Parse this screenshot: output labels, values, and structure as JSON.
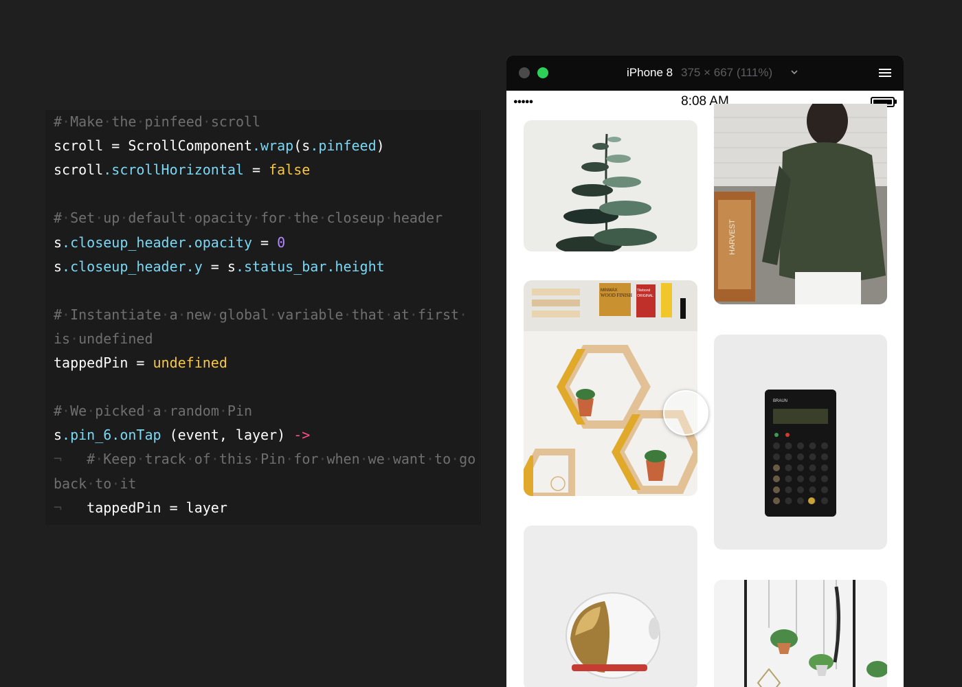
{
  "editor": {
    "lines": [
      {
        "segments": [
          {
            "text": "#",
            "c": "cm"
          },
          {
            "text": "·",
            "c": "ws"
          },
          {
            "text": "Make",
            "c": "cm"
          },
          {
            "text": "·",
            "c": "ws"
          },
          {
            "text": "the",
            "c": "cm"
          },
          {
            "text": "·",
            "c": "ws"
          },
          {
            "text": "pinfeed",
            "c": "cm"
          },
          {
            "text": "·",
            "c": "ws"
          },
          {
            "text": "scroll",
            "c": "cm"
          }
        ]
      },
      {
        "segments": [
          {
            "text": "scroll",
            "c": ""
          },
          {
            "text": " = ",
            "c": ""
          },
          {
            "text": "ScrollComponent",
            "c": ""
          },
          {
            "text": ".wrap",
            "c": "pr"
          },
          {
            "text": "(s",
            "c": ""
          },
          {
            "text": ".pinfeed",
            "c": "pr"
          },
          {
            "text": ")",
            "c": ""
          }
        ]
      },
      {
        "segments": [
          {
            "text": "scroll",
            "c": ""
          },
          {
            "text": ".scrollHorizontal",
            "c": "pr"
          },
          {
            "text": " = ",
            "c": ""
          },
          {
            "text": "false",
            "c": "kw"
          }
        ]
      },
      {
        "segments": []
      },
      {
        "segments": [
          {
            "text": "#",
            "c": "cm"
          },
          {
            "text": "·",
            "c": "ws"
          },
          {
            "text": "Set",
            "c": "cm"
          },
          {
            "text": "·",
            "c": "ws"
          },
          {
            "text": "up",
            "c": "cm"
          },
          {
            "text": "·",
            "c": "ws"
          },
          {
            "text": "default",
            "c": "cm"
          },
          {
            "text": "·",
            "c": "ws"
          },
          {
            "text": "opacity",
            "c": "cm"
          },
          {
            "text": "·",
            "c": "ws"
          },
          {
            "text": "for",
            "c": "cm"
          },
          {
            "text": "·",
            "c": "ws"
          },
          {
            "text": "the",
            "c": "cm"
          },
          {
            "text": "·",
            "c": "ws"
          },
          {
            "text": "closeup",
            "c": "cm"
          },
          {
            "text": "·",
            "c": "ws"
          },
          {
            "text": "header",
            "c": "cm"
          }
        ]
      },
      {
        "segments": [
          {
            "text": "s",
            "c": ""
          },
          {
            "text": ".closeup_header",
            "c": "pr"
          },
          {
            "text": ".opacity",
            "c": "pr"
          },
          {
            "text": " = ",
            "c": ""
          },
          {
            "text": "0",
            "c": "nm"
          }
        ]
      },
      {
        "segments": [
          {
            "text": "s",
            "c": ""
          },
          {
            "text": ".closeup_header",
            "c": "pr"
          },
          {
            "text": ".y",
            "c": "pr"
          },
          {
            "text": " = ",
            "c": ""
          },
          {
            "text": "s",
            "c": ""
          },
          {
            "text": ".status_bar",
            "c": "pr"
          },
          {
            "text": ".height",
            "c": "pr"
          }
        ]
      },
      {
        "segments": []
      },
      {
        "segments": [
          {
            "text": "#",
            "c": "cm"
          },
          {
            "text": "·",
            "c": "ws"
          },
          {
            "text": "Instantiate",
            "c": "cm"
          },
          {
            "text": "·",
            "c": "ws"
          },
          {
            "text": "a",
            "c": "cm"
          },
          {
            "text": "·",
            "c": "ws"
          },
          {
            "text": "new",
            "c": "cm"
          },
          {
            "text": "·",
            "c": "ws"
          },
          {
            "text": "global",
            "c": "cm"
          },
          {
            "text": "·",
            "c": "ws"
          },
          {
            "text": "variable",
            "c": "cm"
          },
          {
            "text": "·",
            "c": "ws"
          },
          {
            "text": "that",
            "c": "cm"
          },
          {
            "text": "·",
            "c": "ws"
          },
          {
            "text": "at",
            "c": "cm"
          },
          {
            "text": "·",
            "c": "ws"
          },
          {
            "text": "first",
            "c": "cm"
          },
          {
            "text": "·",
            "c": "ws"
          }
        ]
      },
      {
        "segments": [
          {
            "text": "is",
            "c": "cm"
          },
          {
            "text": "·",
            "c": "ws"
          },
          {
            "text": "undefined",
            "c": "cm"
          }
        ]
      },
      {
        "segments": [
          {
            "text": "tappedPin",
            "c": ""
          },
          {
            "text": " = ",
            "c": ""
          },
          {
            "text": "undefined",
            "c": "kw"
          }
        ]
      },
      {
        "segments": []
      },
      {
        "segments": [
          {
            "text": "#",
            "c": "cm"
          },
          {
            "text": "·",
            "c": "ws"
          },
          {
            "text": "We",
            "c": "cm"
          },
          {
            "text": "·",
            "c": "ws"
          },
          {
            "text": "picked",
            "c": "cm"
          },
          {
            "text": "·",
            "c": "ws"
          },
          {
            "text": "a",
            "c": "cm"
          },
          {
            "text": "·",
            "c": "ws"
          },
          {
            "text": "random",
            "c": "cm"
          },
          {
            "text": "·",
            "c": "ws"
          },
          {
            "text": "Pin",
            "c": "cm"
          }
        ]
      },
      {
        "segments": [
          {
            "text": "s",
            "c": ""
          },
          {
            "text": ".pin_6",
            "c": "pr"
          },
          {
            "text": ".onTap",
            "c": "pr"
          },
          {
            "text": " (event, layer) ",
            "c": ""
          },
          {
            "text": "->",
            "c": "ar"
          }
        ]
      },
      {
        "segments": [
          {
            "text": "¬   ",
            "c": "ws"
          },
          {
            "text": "#",
            "c": "cm"
          },
          {
            "text": "·",
            "c": "ws"
          },
          {
            "text": "Keep",
            "c": "cm"
          },
          {
            "text": "·",
            "c": "ws"
          },
          {
            "text": "track",
            "c": "cm"
          },
          {
            "text": "·",
            "c": "ws"
          },
          {
            "text": "of",
            "c": "cm"
          },
          {
            "text": "·",
            "c": "ws"
          },
          {
            "text": "this",
            "c": "cm"
          },
          {
            "text": "·",
            "c": "ws"
          },
          {
            "text": "Pin",
            "c": "cm"
          },
          {
            "text": "·",
            "c": "ws"
          },
          {
            "text": "for",
            "c": "cm"
          },
          {
            "text": "·",
            "c": "ws"
          },
          {
            "text": "when",
            "c": "cm"
          },
          {
            "text": "·",
            "c": "ws"
          },
          {
            "text": "we",
            "c": "cm"
          },
          {
            "text": "·",
            "c": "ws"
          },
          {
            "text": "want",
            "c": "cm"
          },
          {
            "text": "·",
            "c": "ws"
          },
          {
            "text": "to",
            "c": "cm"
          },
          {
            "text": "·",
            "c": "ws"
          },
          {
            "text": "go",
            "c": "cm"
          }
        ]
      },
      {
        "segments": [
          {
            "text": "back",
            "c": "cm"
          },
          {
            "text": "·",
            "c": "ws"
          },
          {
            "text": "to",
            "c": "cm"
          },
          {
            "text": "·",
            "c": "ws"
          },
          {
            "text": "it",
            "c": "cm"
          }
        ]
      },
      {
        "segments": [
          {
            "text": "¬   ",
            "c": "ws"
          },
          {
            "text": "tappedPin = layer",
            "c": ""
          }
        ]
      }
    ]
  },
  "device": {
    "name": "iPhone 8",
    "size_label": "375 × 667 (111%)",
    "chevron_icon": "chevron-down-icon",
    "menu_icon": "hamburger-menu-icon",
    "status_bar": {
      "signal": "●●●●●",
      "time": "8:08 AM",
      "battery_icon": "battery-full-icon"
    }
  },
  "pinfeed": {
    "pins": [
      {
        "name": "pin-plant-stem",
        "bg": "#ececea"
      },
      {
        "name": "pin-green-sweater",
        "bg": "#bdbab3"
      },
      {
        "name": "pin-hexagon-shelves",
        "bg": "#f2f2f0"
      },
      {
        "name": "pin-calculator",
        "bg": "#ebebeb"
      },
      {
        "name": "pin-astronaut-helmet",
        "bg": "#ededed"
      },
      {
        "name": "pin-hanging-planters",
        "bg": "#f3f3f3"
      }
    ],
    "product_labels": {
      "wood_finish": "MINWAX WOOD FINISH",
      "titebond": "Titebond ORIGINAL",
      "calculator_brand": "BRAUN",
      "crate_text": "HARVEST"
    }
  },
  "colors": {
    "background": "#1f1f20",
    "comment": "#6f6f6f",
    "property": "#7ad8f5",
    "keyword": "#f8c744",
    "number": "#b388ff",
    "arrow": "#ff4f8b",
    "zoom_light": "#2ed158"
  }
}
